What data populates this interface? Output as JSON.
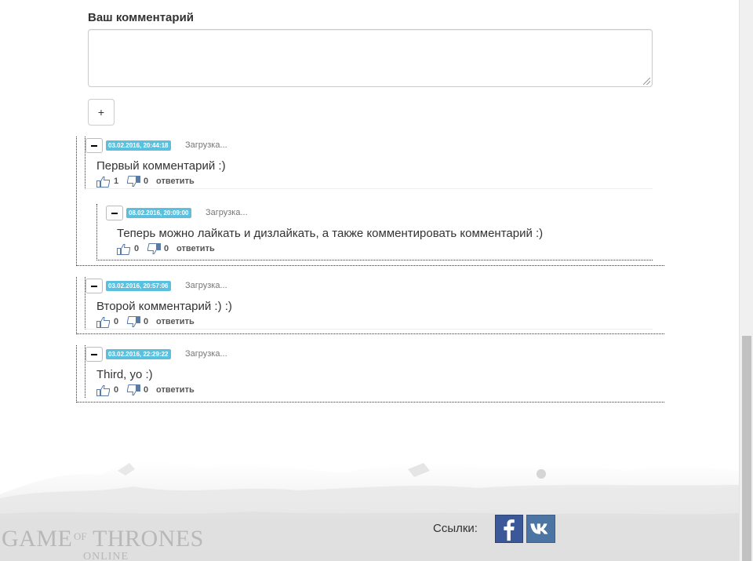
{
  "form": {
    "label": "Ваш комментарий",
    "textarea_value": "",
    "add_button": "+"
  },
  "comments": [
    {
      "date": "03.02.2016, 20:44:18",
      "loading": "Загрузка...",
      "text": "Первый комментарий :)",
      "likes": "1",
      "dislikes": "0",
      "reply": "ответить",
      "replies": [
        {
          "date": "08.02.2016, 20:09:00",
          "loading": "Загрузка...",
          "text": "Теперь можно лайкать и дизлайкать, а также комментировать комментарий :)",
          "likes": "0",
          "dislikes": "0",
          "reply": "ответить"
        }
      ]
    },
    {
      "date": "03.02.2016, 20:57:06",
      "loading": "Загрузка...",
      "text": "Второй комментарий :) :)",
      "likes": "0",
      "dislikes": "0",
      "reply": "ответить"
    },
    {
      "date": "03.02.2016, 22:29:22",
      "loading": "Загрузка...",
      "text": "Third, yo :)",
      "likes": "0",
      "dislikes": "0",
      "reply": "ответить"
    }
  ],
  "footer": {
    "links_label": "Ссылки:",
    "logo_text": "GAME OF THRONES",
    "logo_subtext": "ONLINE"
  },
  "colors": {
    "date_badge": "#5bc0de",
    "facebook": "#3b5998",
    "vk": "#4c75a3",
    "icon": "#5a7ba8"
  },
  "icons": [
    "minus-icon",
    "thumbs-up-icon",
    "thumbs-down-icon",
    "facebook-icon",
    "vk-icon",
    "resize-grip-icon"
  ]
}
